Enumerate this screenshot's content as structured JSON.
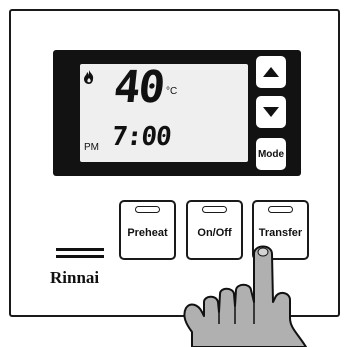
{
  "display": {
    "temperature": "40",
    "unit": "°C",
    "period": "PM",
    "time": "7:00",
    "flame_icon": "flame-icon"
  },
  "side_buttons": {
    "up_icon": "up-arrow-icon",
    "down_icon": "down-arrow-icon",
    "mode_label": "Mode"
  },
  "keys": {
    "preheat_label": "Preheat",
    "onoff_label": "On/Off",
    "transfer_label": "Transfer"
  },
  "brand": {
    "name": "Rinnai"
  },
  "colors": {
    "ink": "#111111",
    "lcd": "#efefef",
    "bezel": "#121212",
    "hand": "#b0b0b0"
  }
}
